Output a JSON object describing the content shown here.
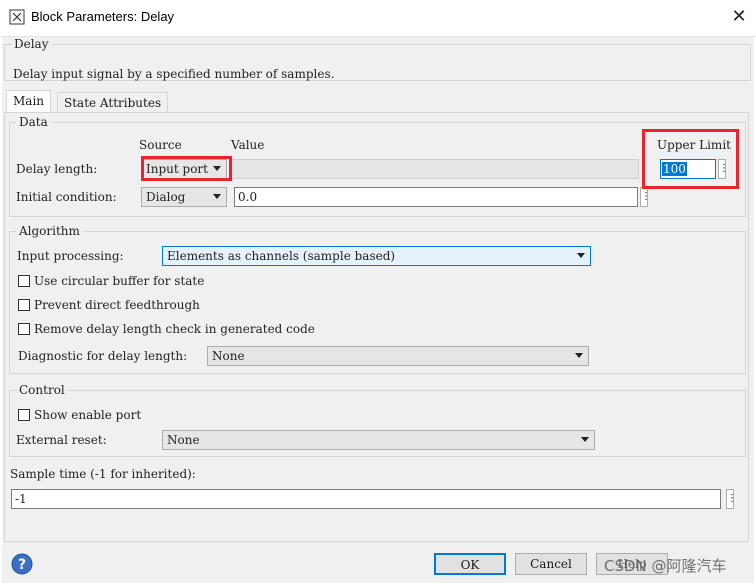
{
  "window": {
    "title": "Block Parameters: Delay",
    "close_symbol": "✕"
  },
  "block": {
    "name": "Delay",
    "description": "Delay input signal by a specified number of samples."
  },
  "tabs": [
    {
      "label": "Main"
    },
    {
      "label": "State Attributes"
    }
  ],
  "data_section": {
    "legend": "Data",
    "col_source": "Source",
    "col_value": "Value",
    "col_upper": "Upper Limit",
    "delay_length_label": "Delay length:",
    "delay_length_source": "Input port",
    "upper_limit_value": "100",
    "initial_condition_label": "Initial condition:",
    "initial_condition_source": "Dialog",
    "initial_condition_value": "0.0"
  },
  "algorithm": {
    "legend": "Algorithm",
    "input_processing_label": "Input processing:",
    "input_processing_value": "Elements as channels (sample based)",
    "circular_buffer_label": "Use circular buffer for state",
    "prevent_feedthrough_label": "Prevent direct feedthrough",
    "remove_check_label": "Remove delay length check in generated code",
    "diagnostic_label": "Diagnostic for delay length:",
    "diagnostic_value": "None"
  },
  "control": {
    "legend": "Control",
    "show_enable_label": "Show enable port",
    "external_reset_label": "External reset:",
    "external_reset_value": "None"
  },
  "sample_time": {
    "label": "Sample time (-1 for inherited):",
    "value": "-1"
  },
  "buttons": {
    "ok": "OK",
    "cancel": "Cancel",
    "help": "Help"
  },
  "watermark": "CSDN @阿隆汽车",
  "colors": {
    "highlight_red": "#e8242e",
    "focus_blue": "#0078d7"
  }
}
